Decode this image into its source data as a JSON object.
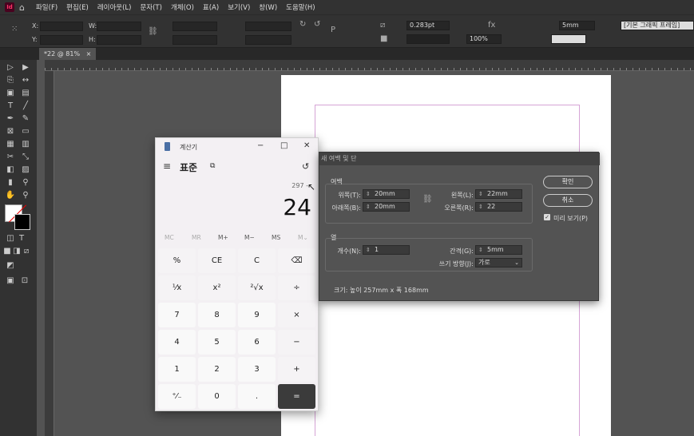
{
  "menubar": {
    "items": [
      "파일(F)",
      "편집(E)",
      "레이아웃(L)",
      "문자(T)",
      "개체(O)",
      "표(A)",
      "보기(V)",
      "창(W)",
      "도움말(H)"
    ]
  },
  "control": {
    "x_label": "X:",
    "y_label": "Y:",
    "w_label": "W:",
    "h_label": "H:",
    "stroke_weight": "0.283pt",
    "zoom": "100%",
    "gap": "5mm",
    "frame_style": "[기본 그래픽 프레임]"
  },
  "document": {
    "tab_label": "*22 @ 81%",
    "tab_close": "×"
  },
  "calculator": {
    "title": "계산기",
    "mode": "표준",
    "expression": "297 -",
    "display": "24",
    "memory": [
      "MC",
      "MR",
      "M+",
      "M−",
      "MS",
      "M⌄"
    ],
    "keys": [
      [
        "%",
        "CE",
        "C",
        "⌫"
      ],
      [
        "¹⁄x",
        "x²",
        "²√x",
        "÷"
      ],
      [
        "7",
        "8",
        "9",
        "×"
      ],
      [
        "4",
        "5",
        "6",
        "−"
      ],
      [
        "1",
        "2",
        "3",
        "+"
      ],
      [
        "⁺⁄₋",
        "0",
        ".",
        "="
      ]
    ]
  },
  "dialog": {
    "title": "새 여백 및 단",
    "margin_group": "여백",
    "top_label": "위쪽(T):",
    "top_value": "20mm",
    "bottom_label": "아래쪽(B):",
    "bottom_value": "20mm",
    "left_label": "왼쪽(L):",
    "left_value": "22mm",
    "right_label": "오른쪽(R):",
    "right_value": "22",
    "column_group": "열",
    "count_label": "개수(N):",
    "count_value": "1",
    "gutter_label": "간격(G):",
    "gutter_value": "5mm",
    "direction_label": "쓰기 방향(J):",
    "direction_value": "가로",
    "size_text": "크기: 높이 257mm x 폭 168mm",
    "ok_label": "확인",
    "cancel_label": "취소",
    "preview_label": "미리 보기(P)"
  }
}
